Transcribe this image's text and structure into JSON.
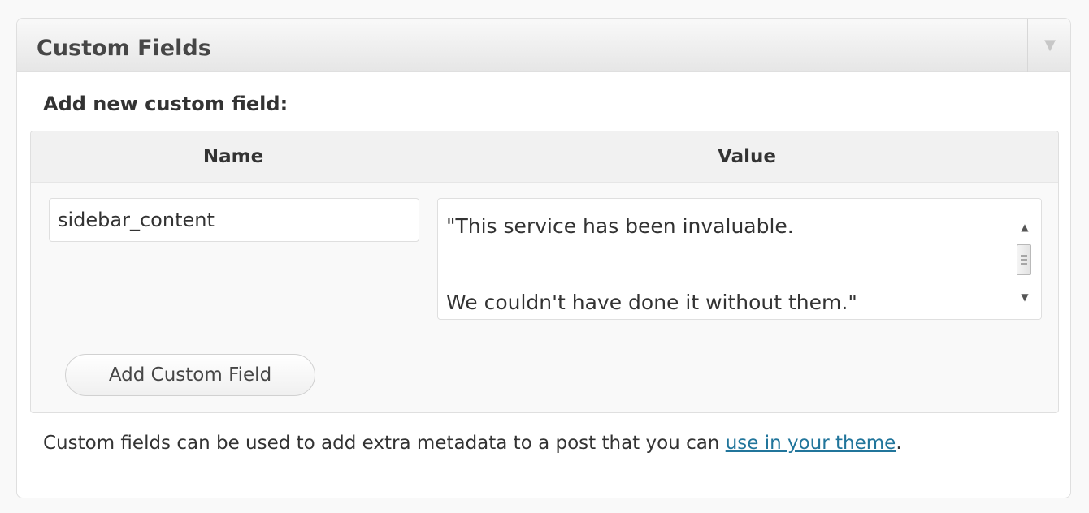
{
  "postbox": {
    "title": "Custom Fields",
    "toggle_icon": "arrow-down-icon"
  },
  "form": {
    "heading": "Add new custom field:",
    "columns": {
      "name": "Name",
      "value": "Value"
    },
    "name_value": "sidebar_content",
    "value_text": "\"This service has been invaluable.\n\nWe couldn't have done it without them.\"",
    "add_button_label": "Add Custom Field"
  },
  "help": {
    "text_before": "Custom fields can be used to add extra metadata to a post that you can ",
    "link_text": "use in your theme",
    "text_after": "."
  },
  "colors": {
    "link": "#21759b",
    "header_bg_top": "#f9f9f9",
    "header_bg_bottom": "#e6e6e6",
    "border": "#dfdfdf"
  }
}
